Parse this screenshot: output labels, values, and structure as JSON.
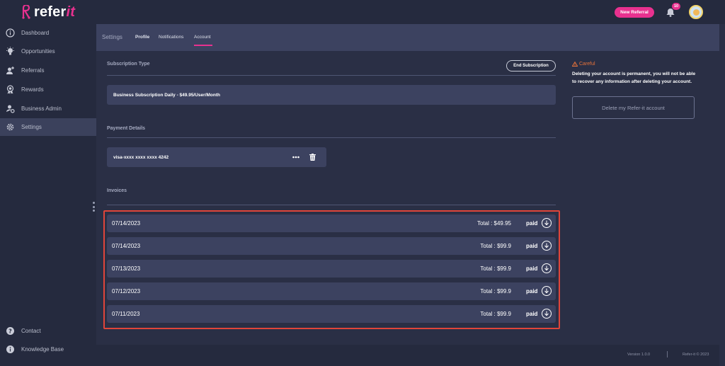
{
  "brand": {
    "name_main": "refer",
    "name_accent": "it",
    "accent_color": "#e8318f"
  },
  "topbar": {
    "new_referral_label": "New Referral",
    "notifications_count": "10"
  },
  "sidebar": {
    "items": [
      {
        "label": "Dashboard",
        "icon": "info-circle-icon"
      },
      {
        "label": "Opportunities",
        "icon": "lightbulb-icon"
      },
      {
        "label": "Referrals",
        "icon": "add-user-icon"
      },
      {
        "label": "Rewards",
        "icon": "award-icon"
      },
      {
        "label": "Business Admin",
        "icon": "business-admin-icon"
      },
      {
        "label": "Settings",
        "icon": "gear-icon",
        "active": true
      }
    ],
    "bottom_items": [
      {
        "label": "Contact",
        "icon": "help-icon"
      },
      {
        "label": "Knowledge Base",
        "icon": "info-icon"
      }
    ]
  },
  "settings": {
    "title": "Settings",
    "tabs": [
      {
        "label": "Profile"
      },
      {
        "label": "Notifications"
      },
      {
        "label": "Account",
        "active": true
      }
    ]
  },
  "subscription": {
    "label": "Subscription Type",
    "end_button": "End Subscription",
    "plan": "Business Subscription Daily - $49.95/User/Month"
  },
  "payment": {
    "label": "Payment Details",
    "card": "visa-xxxx xxxx xxxx 4242"
  },
  "invoices": {
    "label": "Invoices",
    "rows": [
      {
        "date": "07/14/2023",
        "total": "Total : $49.95",
        "status": "paid"
      },
      {
        "date": "07/14/2023",
        "total": "Total : $99.9",
        "status": "paid"
      },
      {
        "date": "07/13/2023",
        "total": "Total : $99.9",
        "status": "paid"
      },
      {
        "date": "07/12/2023",
        "total": "Total : $99.9",
        "status": "paid"
      },
      {
        "date": "07/11/2023",
        "total": "Total : $99.9",
        "status": "paid"
      }
    ]
  },
  "careful": {
    "title": "Careful",
    "text": "Deleting your account is permanent, you will not be able to recover any information after deleting your account.",
    "delete_button": "Delete my Refer-it account"
  },
  "footer": {
    "version": "Version 1.0.0",
    "copyright": "Refer-it © 2023"
  }
}
